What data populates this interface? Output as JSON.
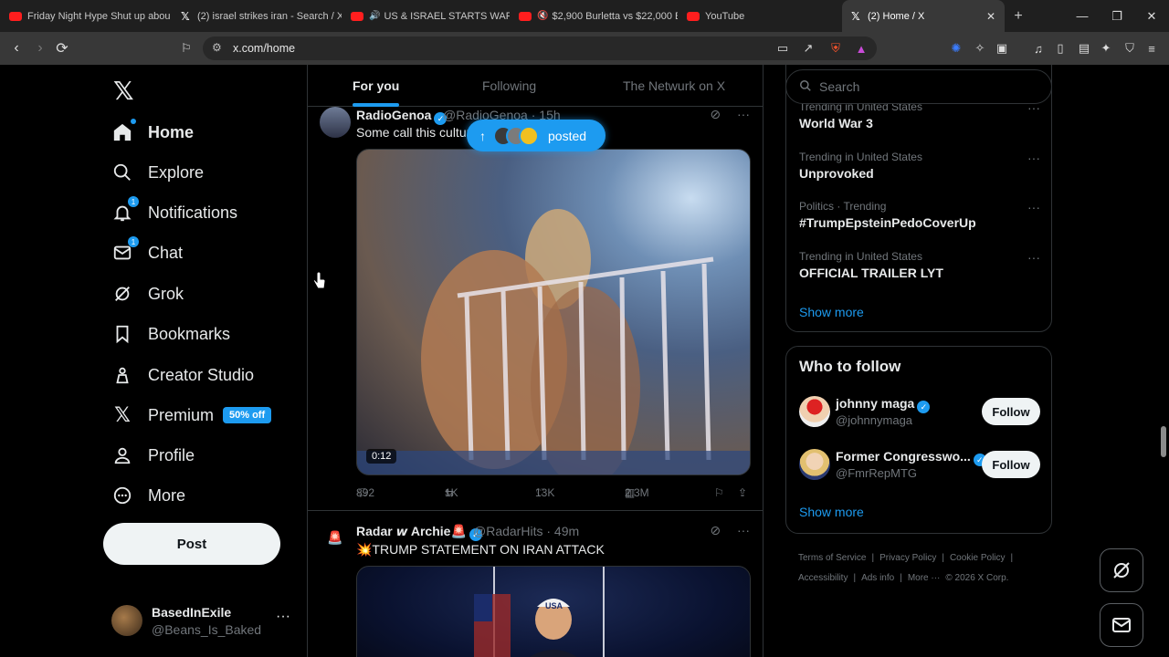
{
  "browser": {
    "tabs": [
      {
        "title": "Friday Night Hype Shut up abou",
        "icon": "youtube-icon"
      },
      {
        "title": "(2) israel strikes iran - Search / X",
        "icon": "x-icon"
      },
      {
        "title": "US & ISRAEL STARTS WAR W",
        "icon": "youtube-icon"
      },
      {
        "title": "$2,900 Burletta vs $22,000 B",
        "icon": "youtube-icon"
      },
      {
        "title": "YouTube",
        "icon": "youtube-icon"
      },
      {
        "title": "(2) Home / X",
        "icon": "x-icon"
      }
    ],
    "url": "x.com/home"
  },
  "nav": {
    "items": [
      {
        "label": "Home",
        "icon": "home-icon"
      },
      {
        "label": "Explore",
        "icon": "search-icon"
      },
      {
        "label": "Notifications",
        "icon": "bell-icon",
        "badge": "1"
      },
      {
        "label": "Chat",
        "icon": "mail-icon",
        "badge": "1"
      },
      {
        "label": "Grok",
        "icon": "grok-icon"
      },
      {
        "label": "Bookmarks",
        "icon": "bookmark-icon"
      },
      {
        "label": "Creator Studio",
        "icon": "creator-studio-icon"
      },
      {
        "label": "Premium",
        "icon": "x-icon",
        "promo": "50% off"
      },
      {
        "label": "Profile",
        "icon": "person-icon"
      },
      {
        "label": "More",
        "icon": "more-circle-icon"
      }
    ],
    "post_label": "Post",
    "account": {
      "name": "BasedInExile",
      "handle": "@Beans_Is_Baked"
    }
  },
  "feed": {
    "tabs": [
      "For you",
      "Following",
      "The Netwurk on X"
    ],
    "new_posts_pill": "posted",
    "tweets": [
      {
        "name": "RadioGenoa",
        "handle": "@RadioGenoa",
        "time": "15h",
        "text": "Some call this culture",
        "video_duration": "0:12",
        "replies": "892",
        "reposts": "1K",
        "likes": "13K",
        "views": "2.3M"
      },
      {
        "name": "Radar 𝙬 Archie🚨",
        "handle": "@RadarHits",
        "time": "49m",
        "text": "💥TRUMP STATEMENT ON IRAN ATTACK",
        "cap_text": "USA"
      }
    ]
  },
  "sidebar": {
    "search_placeholder": "Search",
    "trends": [
      {
        "context": "Trending in United States",
        "title": "World War 3"
      },
      {
        "context": "Trending in United States",
        "title": "Unprovoked"
      },
      {
        "context": "Politics · Trending",
        "title": "#TrumpEpsteinPedoCoverUp"
      },
      {
        "context": "Trending in United States",
        "title": "OFFICIAL TRAILER LYT"
      }
    ],
    "show_more": "Show more",
    "who_to_follow": {
      "title": "Who to follow",
      "accounts": [
        {
          "name": "johnny maga",
          "handle": "@johnnymaga"
        },
        {
          "name": "Former Congresswo...",
          "handle": "@FmrRepMTG"
        }
      ],
      "follow_label": "Follow",
      "show_more": "Show more"
    },
    "footer": [
      "Terms of Service",
      "|",
      "Privacy Policy",
      "|",
      "Cookie Policy",
      "|",
      "Accessibility",
      "|",
      "Ads info",
      "|",
      "More ···",
      "© 2026 X Corp."
    ]
  },
  "colors": {
    "accent": "#1d9bf0",
    "background": "#000000",
    "border": "#2f3336",
    "muted": "#71767b"
  }
}
